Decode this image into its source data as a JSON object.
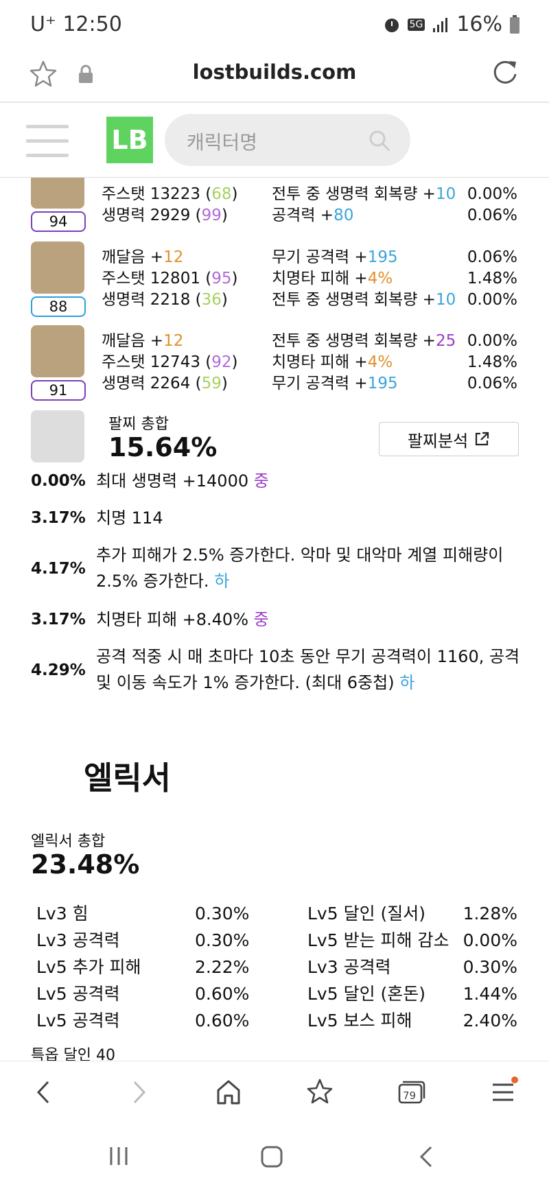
{
  "status": {
    "carrier": "U⁺ 12:50",
    "network": "5G",
    "battery": "16%"
  },
  "browser": {
    "url": "lostbuilds.com",
    "tab_count": "79"
  },
  "site": {
    "logo": "LB",
    "search_placeholder": "캐릭터명"
  },
  "accessories": [
    {
      "level": "94",
      "stats": [
        [
          "주스탯 13223 (",
          "68",
          ")"
        ],
        [
          "생명력 2929 (",
          "99",
          ")"
        ]
      ],
      "effects": [
        [
          "전투 중 생명력 회복량 +",
          "10"
        ],
        [
          "공격력 +",
          "80"
        ]
      ],
      "pcts": [
        "0.00%",
        "0.06%"
      ]
    },
    {
      "level": "88",
      "stats": [
        [
          "깨달음 +",
          "12",
          ""
        ],
        [
          "주스탯 12801 (",
          "95",
          ")"
        ],
        [
          "생명력 2218 (",
          "36",
          ")"
        ]
      ],
      "effects": [
        [
          "무기 공격력 +",
          "195"
        ],
        [
          "치명타 피해 +",
          "4%"
        ],
        [
          "전투 중 생명력 회복량 +",
          "10"
        ]
      ],
      "pcts": [
        "0.06%",
        "1.48%",
        "0.00%"
      ]
    },
    {
      "level": "91",
      "stats": [
        [
          "깨달음 +",
          "12",
          ""
        ],
        [
          "주스탯 12743 (",
          "92",
          ")"
        ],
        [
          "생명력 2264 (",
          "59",
          ")"
        ]
      ],
      "effects": [
        [
          "전투 중 생명력 회복량 +",
          "25"
        ],
        [
          "치명타 피해 +",
          "4%"
        ],
        [
          "무기 공격력 +",
          "195"
        ]
      ],
      "pcts": [
        "0.00%",
        "1.48%",
        "0.06%"
      ]
    }
  ],
  "bracelet": {
    "label": "팔찌 총합",
    "total": "15.64%",
    "analyze_button": "팔찌분석",
    "effects": [
      {
        "pct": "0.00%",
        "text": "최대 생명력 +14000 ",
        "grade": "중"
      },
      {
        "pct": "3.17%",
        "text": "치명 114",
        "grade": ""
      },
      {
        "pct": "4.17%",
        "text": "추가 피해가 2.5% 증가한다. 악마 및 대악마 계열 피해량이 2.5% 증가한다. ",
        "grade": "하"
      },
      {
        "pct": "3.17%",
        "text": "치명타 피해 +8.40% ",
        "grade": "중"
      },
      {
        "pct": "4.29%",
        "text": "공격 적중 시 매 초마다 10초 동안 무기 공격력이 1160, 공격 및 이동 속도가 1% 증가한다. (최대 6중첩) ",
        "grade": "하"
      }
    ]
  },
  "elixir": {
    "heading": "엘릭서",
    "label": "엘릭서 총합",
    "total": "23.48%",
    "left": [
      {
        "name": "Lv3 힘",
        "pct": "0.30%"
      },
      {
        "name": "Lv3 공격력",
        "pct": "0.30%"
      },
      {
        "name": "Lv5 추가 피해",
        "pct": "2.22%"
      },
      {
        "name": "Lv5 공격력",
        "pct": "0.60%"
      },
      {
        "name": "Lv5 공격력",
        "pct": "0.60%"
      }
    ],
    "right": [
      {
        "name": "Lv5 달인 (질서)",
        "pct": "1.28%"
      },
      {
        "name": "Lv5 받는 피해 감소",
        "pct": "0.00%"
      },
      {
        "name": "Lv3 공격력",
        "pct": "0.30%"
      },
      {
        "name": "Lv5 달인 (혼돈)",
        "pct": "1.44%"
      },
      {
        "name": "Lv5 보스 피해",
        "pct": "2.40%"
      }
    ],
    "cut_text": "특옵 달인 40"
  }
}
